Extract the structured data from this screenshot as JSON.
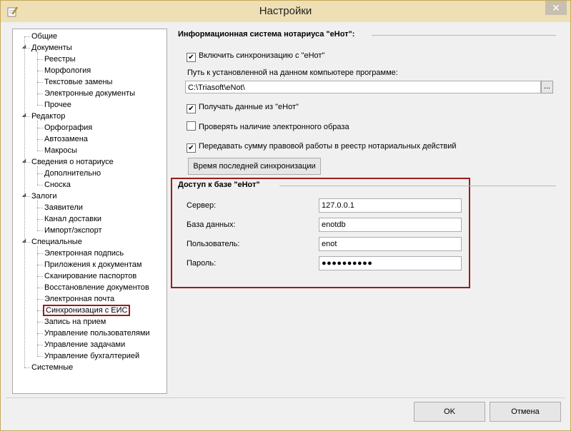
{
  "window": {
    "title": "Настройки",
    "close_glyph": "✕"
  },
  "tree": {
    "items": [
      {
        "label": "Общие",
        "level": 0,
        "expander": ""
      },
      {
        "label": "Документы",
        "level": 0,
        "expander": "◢"
      },
      {
        "label": "Реестры",
        "level": 1
      },
      {
        "label": "Морфология",
        "level": 1
      },
      {
        "label": "Текстовые замены",
        "level": 1
      },
      {
        "label": "Электронные документы",
        "level": 1
      },
      {
        "label": "Прочее",
        "level": 1
      },
      {
        "label": "Редактор",
        "level": 0,
        "expander": "◢"
      },
      {
        "label": "Орфография",
        "level": 1
      },
      {
        "label": "Автозамена",
        "level": 1
      },
      {
        "label": "Макросы",
        "level": 1
      },
      {
        "label": "Сведения о нотариусе",
        "level": 0,
        "expander": "◢"
      },
      {
        "label": "Дополнительно",
        "level": 1
      },
      {
        "label": "Сноска",
        "level": 1
      },
      {
        "label": "Залоги",
        "level": 0,
        "expander": "◢"
      },
      {
        "label": "Заявители",
        "level": 1
      },
      {
        "label": "Канал доставки",
        "level": 1
      },
      {
        "label": "Импорт/экспорт",
        "level": 1
      },
      {
        "label": "Специальные",
        "level": 0,
        "expander": "◢"
      },
      {
        "label": "Электронная подпись",
        "level": 1
      },
      {
        "label": "Приложения к документам",
        "level": 1
      },
      {
        "label": "Сканирование паспортов",
        "level": 1
      },
      {
        "label": "Восстановление документов",
        "level": 1
      },
      {
        "label": "Электронная почта",
        "level": 1
      },
      {
        "label": "Синхронизация с ЕИС",
        "level": 1,
        "selected": true
      },
      {
        "label": "Запись на прием",
        "level": 1
      },
      {
        "label": "Управление пользователями",
        "level": 1
      },
      {
        "label": "Управление задачами",
        "level": 1
      },
      {
        "label": "Управление бухгалтерией",
        "level": 1
      },
      {
        "label": "Системные",
        "level": 0,
        "expander": ""
      }
    ]
  },
  "eis": {
    "section_title": "Информационная система нотариуса \"еНот\":",
    "enable_sync": {
      "label": "Включить синхронизацию с \"еНот\"",
      "checked": true
    },
    "path_label": "Путь к установленной на данном компьютере программе:",
    "path_value": "C:\\Triasoft\\eNot\\",
    "browse_label": "...",
    "receive_data": {
      "label": "Получать данные из \"еНот\"",
      "checked": true
    },
    "check_image": {
      "label": "Проверять наличие электронного образа",
      "checked": false
    },
    "send_sum": {
      "label": "Передавать сумму правовой работы в реестр нотариальных действий",
      "checked": true
    },
    "last_sync_button": "Время последней синхронизации",
    "check_glyph": "✔"
  },
  "db": {
    "section_title": "Доступ к базе \"еНот\"",
    "server_label": "Сервер:",
    "server_value": "127.0.0.1",
    "database_label": "База данных:",
    "database_value": "enotdb",
    "user_label": "Пользователь:",
    "user_value": "enot",
    "password_label": "Пароль:",
    "password_value": "●●●●●●●●●●"
  },
  "footer": {
    "ok_label": "OK",
    "cancel_label": "Отмена"
  }
}
